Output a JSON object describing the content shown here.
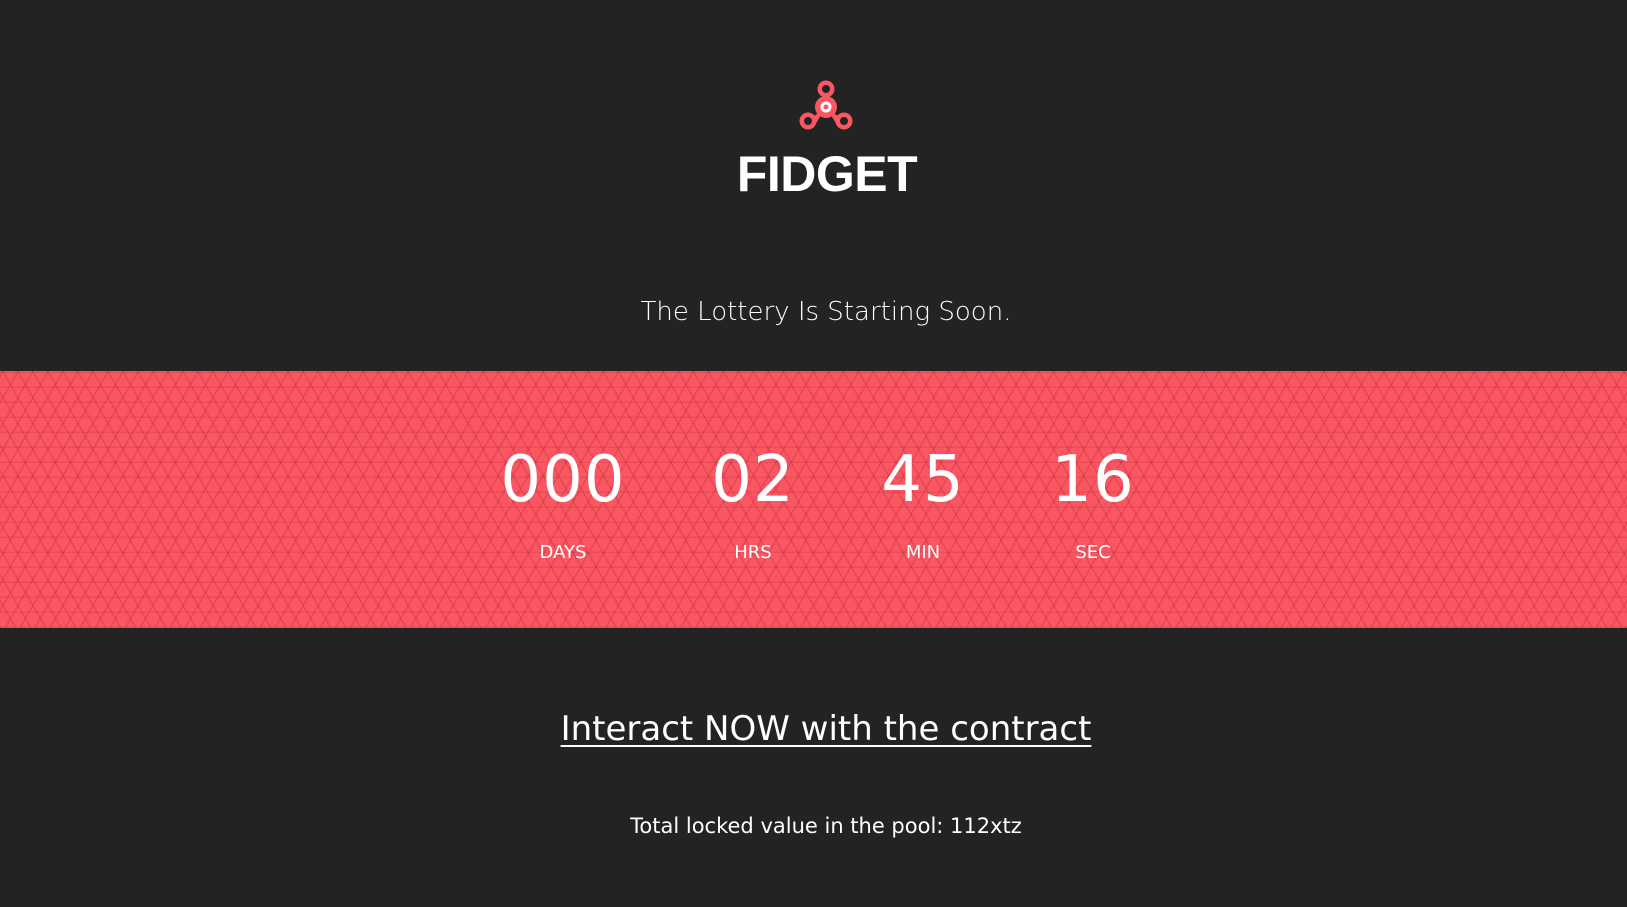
{
  "brand": {
    "logo_icon": "fidget-spinner-icon",
    "title": "FIDGET"
  },
  "tagline": "The Lottery Is Starting Soon.",
  "countdown": {
    "days": {
      "value": "000",
      "label": "DAYS"
    },
    "hours": {
      "value": "02",
      "label": "HRS"
    },
    "minutes": {
      "value": "45",
      "label": "MIN"
    },
    "seconds": {
      "value": "16",
      "label": "SEC"
    }
  },
  "cta": {
    "label": "Interact NOW with the contract"
  },
  "pool": {
    "text": "Total locked value in the pool: 112xtz"
  },
  "colors": {
    "background": "#232323",
    "accent": "#fb5762",
    "text": "#ffffff"
  }
}
